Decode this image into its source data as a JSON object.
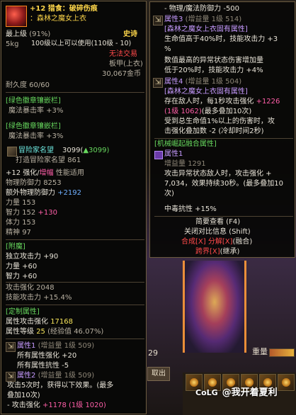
{
  "left": {
    "title": "+12 猎食：破碎伤痕",
    "subtitle": "：森林之魔女上衣",
    "level_label": "最上级",
    "level_pct": "(91%)",
    "rarity": "史诗",
    "weight": "5kg",
    "use_req": "100级以上可以使用(110级 - 10)",
    "no_trade": "无法交易",
    "slot_type": "板甲(上衣)",
    "price": "30,067金币",
    "durability": "耐久度 60/60",
    "emblem1_title": "[绿色徽章镶嵌栏]",
    "emblem1_stat": "魔法暴击率 +3%",
    "emblem2_title": "[绿色徽章镶嵌栏]",
    "emblem2_stat": "魔法暴击率 +3%",
    "adventurer_label": "冒险家名望",
    "adventurer_value": "3099(",
    "adventurer_up": "▲3099)",
    "forge_label": "打造冒险家名望",
    "forge_value": "861",
    "reinforce_prefix": "+12",
    "reinforce_mid": "强化/",
    "reinforce_amp": "增幅",
    "reinforce_suffix": "性能适用",
    "phys_def_label": "物理防御力",
    "phys_def_value": "8253",
    "extra_def_label": "额外物理防御力",
    "extra_def_value": "+2192",
    "stat_str": "力量",
    "stat_str_v": "153",
    "stat_int": "智力",
    "stat_int_v": "152",
    "stat_int_bonus": "+130",
    "stat_vit": "体力",
    "stat_vit_v": "153",
    "stat_spi": "精神",
    "stat_spi_v": "97",
    "appendix_title": "[附魔]",
    "app_1": "独立攻击力 +90",
    "app_2": "力量 +60",
    "app_3": "智力 +60",
    "atk_boost": "攻击强化 2048",
    "skill_atk": "技能攻击力 +15.4%",
    "custom_title": "[定制属性]",
    "custom_atk_label": "属性攻击强化",
    "custom_atk_value": "17168",
    "custom_lv_label": "属性等级",
    "custom_lv_value": "25",
    "custom_lv_exp": "(经验值 46.07%)",
    "attr1_title": "属性1",
    "attr1_tag": "(增益量 1级 509)",
    "attr1_l1": "所有属性强化 +20",
    "attr1_l2": "所有属性抗性 -5",
    "attr2_title": "属性2",
    "attr2_tag": "(增益量 1级 509)",
    "attr2_l1": "攻击5次时，获得以下效果。(最多",
    "attr2_l2": "叠加10次)",
    "attr2_l3_pre": "- 攻击强化",
    "attr2_l3_val": "+1178",
    "attr2_l3_tag": "(1级 1020)"
  },
  "right": {
    "line1": "- 物理/魔法防御力 -500",
    "prop3_title": "属性3",
    "prop3_tag": "(增益量 1级 514)",
    "prop3_set": "[森林之魔女上衣固有属性]",
    "prop3_l1": "生命值高于40%时，技能攻击力 +3",
    "prop3_l2": "%",
    "prop3_l3": "数值最高的异常状态伤害增加量",
    "prop3_l4": "低于20%时，技能攻击力 +4%",
    "prop4_title": "属性4",
    "prop4_tag": "(增益量 1级 504)",
    "prop4_set": "[森林之魔女上衣固有属性]",
    "prop4_l1_pre": "存在敌人时，每1秒攻击强化",
    "prop4_l1_val": "+1226",
    "prop4_l2_tag": "(1级 1062)",
    "prop4_l2_suf": "(最多叠加10次)",
    "prop4_l3": "受到总生命值1%以上的伤害时，攻",
    "prop4_l4": "击强化叠加数 -2 (冷却时间2秒)",
    "mech_title": "[机械崛起融合属性]",
    "mech_attr": "属性1",
    "mech_amp": "增益量",
    "mech_amp_val": "1291",
    "mech_l1": "攻击异常状态敌人时，攻击强化 +",
    "mech_l2": "7,034，效果持续30秒。(最多叠加10",
    "mech_l3": "次)",
    "mid_res": "中毒抗性 +15%",
    "btn_simple": "简要查看 (F4)",
    "btn_compare": "关闭对比信息 (Shift)",
    "btn_combine_a": "合成[X]",
    "btn_combine_b": "分解[X]",
    "btn_combine_c": "(融合)",
    "btn_cross_a": "跨界[X]",
    "btn_cross_b": "(继承)"
  },
  "game": {
    "leave_btn": "取出",
    "weight_label": "重量",
    "side_num": "29",
    "watermark_brand": "CoLG",
    "watermark_text": "@我开着夏利"
  },
  "icons": {
    "item": "broken-scar-armor-icon",
    "emblem": "emblem-socket-icon",
    "adventurer": "adventurer-fame-icon",
    "arrow": "arrow-icon"
  }
}
